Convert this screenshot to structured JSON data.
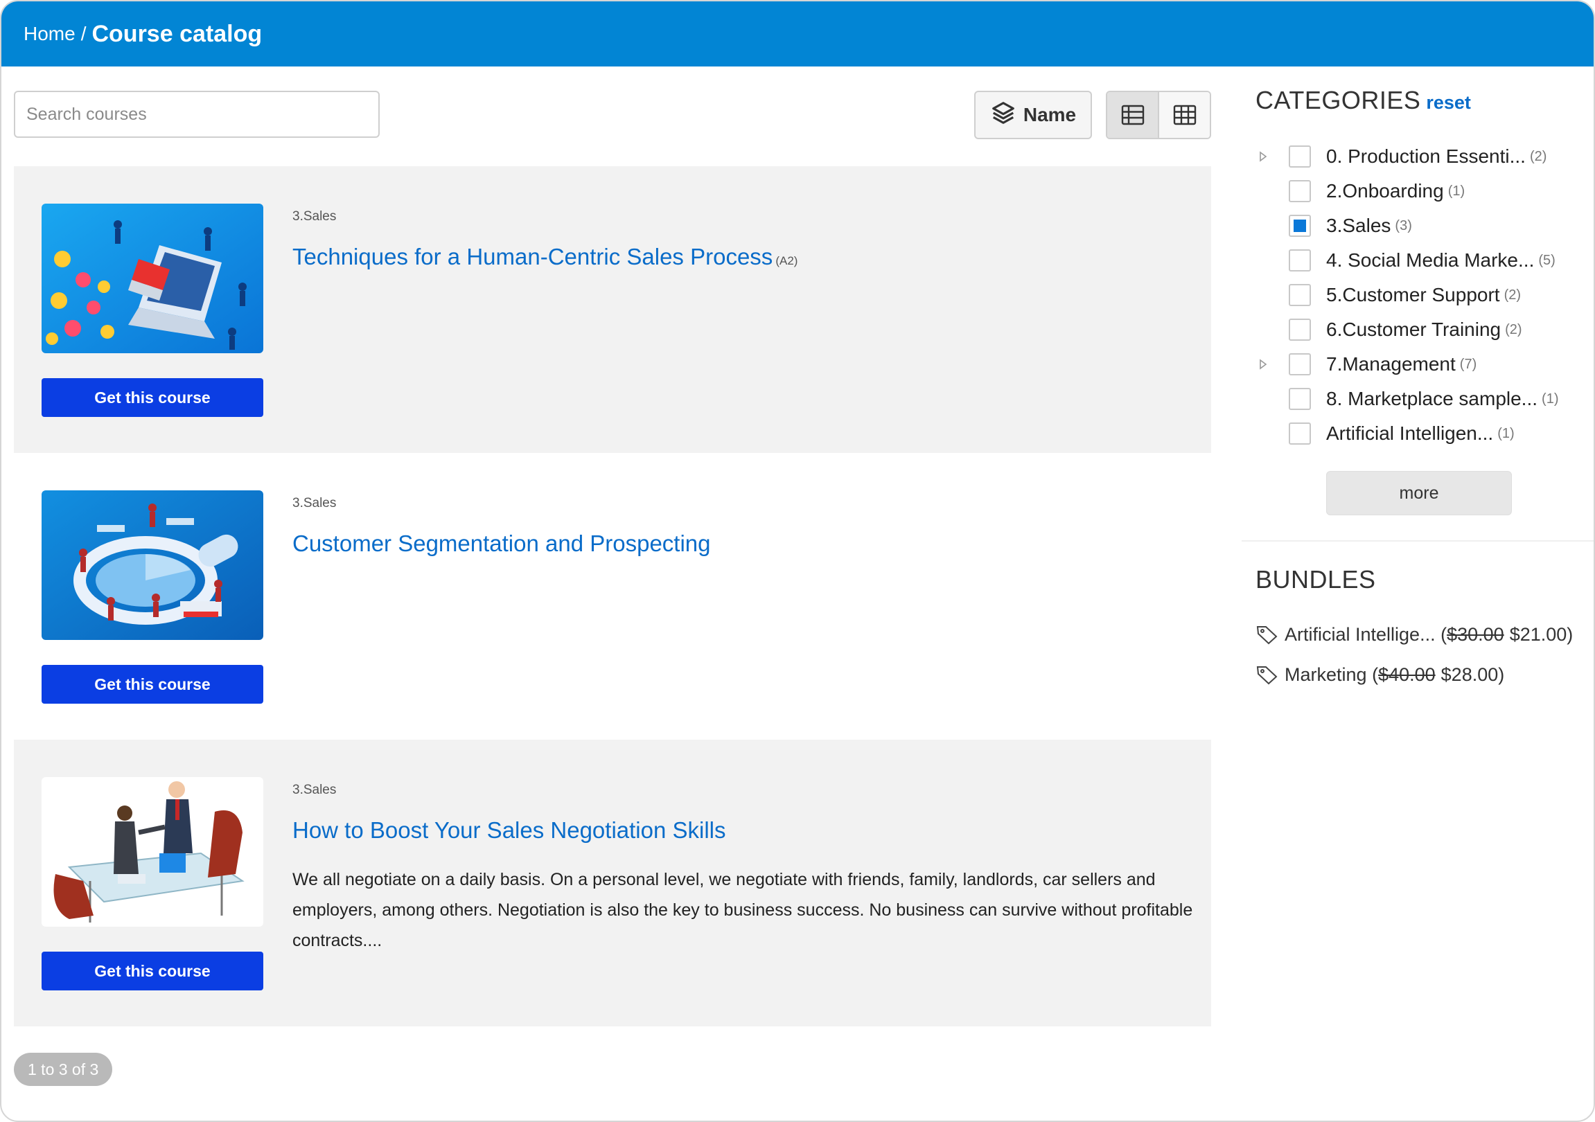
{
  "breadcrumb": {
    "home": "Home",
    "separator": "/",
    "current": "Course catalog"
  },
  "search": {
    "placeholder": "Search courses",
    "value": ""
  },
  "toolbar": {
    "sort_label": "Name"
  },
  "courses": [
    {
      "category": "3.Sales",
      "title": "Techniques for a Human-Centric Sales Process",
      "level": "(A2)",
      "description": "",
      "button": "Get this course"
    },
    {
      "category": "3.Sales",
      "title": "Customer Segmentation and Prospecting",
      "level": "",
      "description": "",
      "button": "Get this course"
    },
    {
      "category": "3.Sales",
      "title": "How to Boost Your Sales Negotiation Skills",
      "level": "",
      "description": "We all negotiate on a daily basis. On a personal level, we negotiate with friends, family, landlords, car sellers and employers, among others. Negotiation is also the key to business success. No business can survive without profitable contracts....",
      "button": "Get this course"
    }
  ],
  "pager": {
    "label": "1 to 3 of 3"
  },
  "categories": {
    "title": "CATEGORIES",
    "reset": "reset",
    "more": "more",
    "items": [
      {
        "label": "0. Production Essenti...",
        "count": "(2)",
        "checked": false,
        "expandable": true
      },
      {
        "label": "2.Onboarding",
        "count": "(1)",
        "checked": false,
        "expandable": false
      },
      {
        "label": "3.Sales",
        "count": "(3)",
        "checked": true,
        "expandable": false
      },
      {
        "label": "4. Social Media Marke...",
        "count": "(5)",
        "checked": false,
        "expandable": false
      },
      {
        "label": "5.Customer Support",
        "count": "(2)",
        "checked": false,
        "expandable": false
      },
      {
        "label": "6.Customer Training",
        "count": "(2)",
        "checked": false,
        "expandable": false
      },
      {
        "label": "7.Management",
        "count": "(7)",
        "checked": false,
        "expandable": true
      },
      {
        "label": "8. Marketplace sample...",
        "count": "(1)",
        "checked": false,
        "expandable": false
      },
      {
        "label": "Artificial Intelligen...",
        "count": "(1)",
        "checked": false,
        "expandable": false
      }
    ]
  },
  "bundles": {
    "title": "BUNDLES",
    "items": [
      {
        "name": "Artificial Intellige...",
        "open": "(",
        "old_price": "$30.00",
        "new_price": "$21.00",
        "close": ")"
      },
      {
        "name": "Marketing",
        "open": "(",
        "old_price": "$40.00",
        "new_price": "$28.00",
        "close": ")"
      }
    ]
  },
  "colors": {
    "header": "#0285d4",
    "link": "#0a6cc9",
    "button": "#0b3ee3",
    "checkbox": "#0a78d8"
  }
}
